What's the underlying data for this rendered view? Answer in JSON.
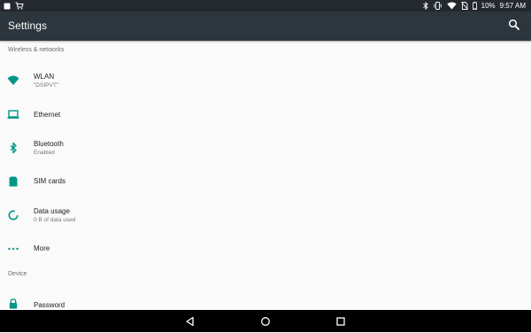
{
  "status_bar": {
    "battery_percent": "10%",
    "time": "9:57 AM",
    "icons": [
      "notification-square-icon",
      "shopping-cart-icon",
      "bluetooth-icon",
      "vibrate-icon",
      "wifi-icon",
      "no-sim-icon",
      "battery-icon"
    ]
  },
  "app_bar": {
    "title": "Settings",
    "search_icon": "search-icon"
  },
  "sections": {
    "wireless": {
      "header": "Wireless & networks"
    },
    "device": {
      "header": "Device"
    }
  },
  "items": {
    "wlan": {
      "title": "WLAN",
      "summary": "\"DSIPVT\"",
      "icon": "wifi-icon"
    },
    "ethernet": {
      "title": "Ethernet",
      "icon": "laptop-icon"
    },
    "bluetooth": {
      "title": "Bluetooth",
      "summary": "Enabled",
      "icon": "bluetooth-icon"
    },
    "sim": {
      "title": "SIM cards",
      "icon": "sim-card-icon"
    },
    "data_usage": {
      "title": "Data usage",
      "summary": "0 B of data used",
      "icon": "data-usage-icon"
    },
    "more": {
      "title": "More",
      "icon": "more-horiz-icon"
    },
    "password": {
      "title": "Password",
      "icon": "lock-icon"
    }
  },
  "nav_bar": {
    "icons": [
      "back-icon",
      "home-icon",
      "recents-icon"
    ]
  },
  "colors": {
    "accent": "#009688",
    "status_bar": "#23292e",
    "app_bar": "#2d363c",
    "background": "#fafafa"
  }
}
